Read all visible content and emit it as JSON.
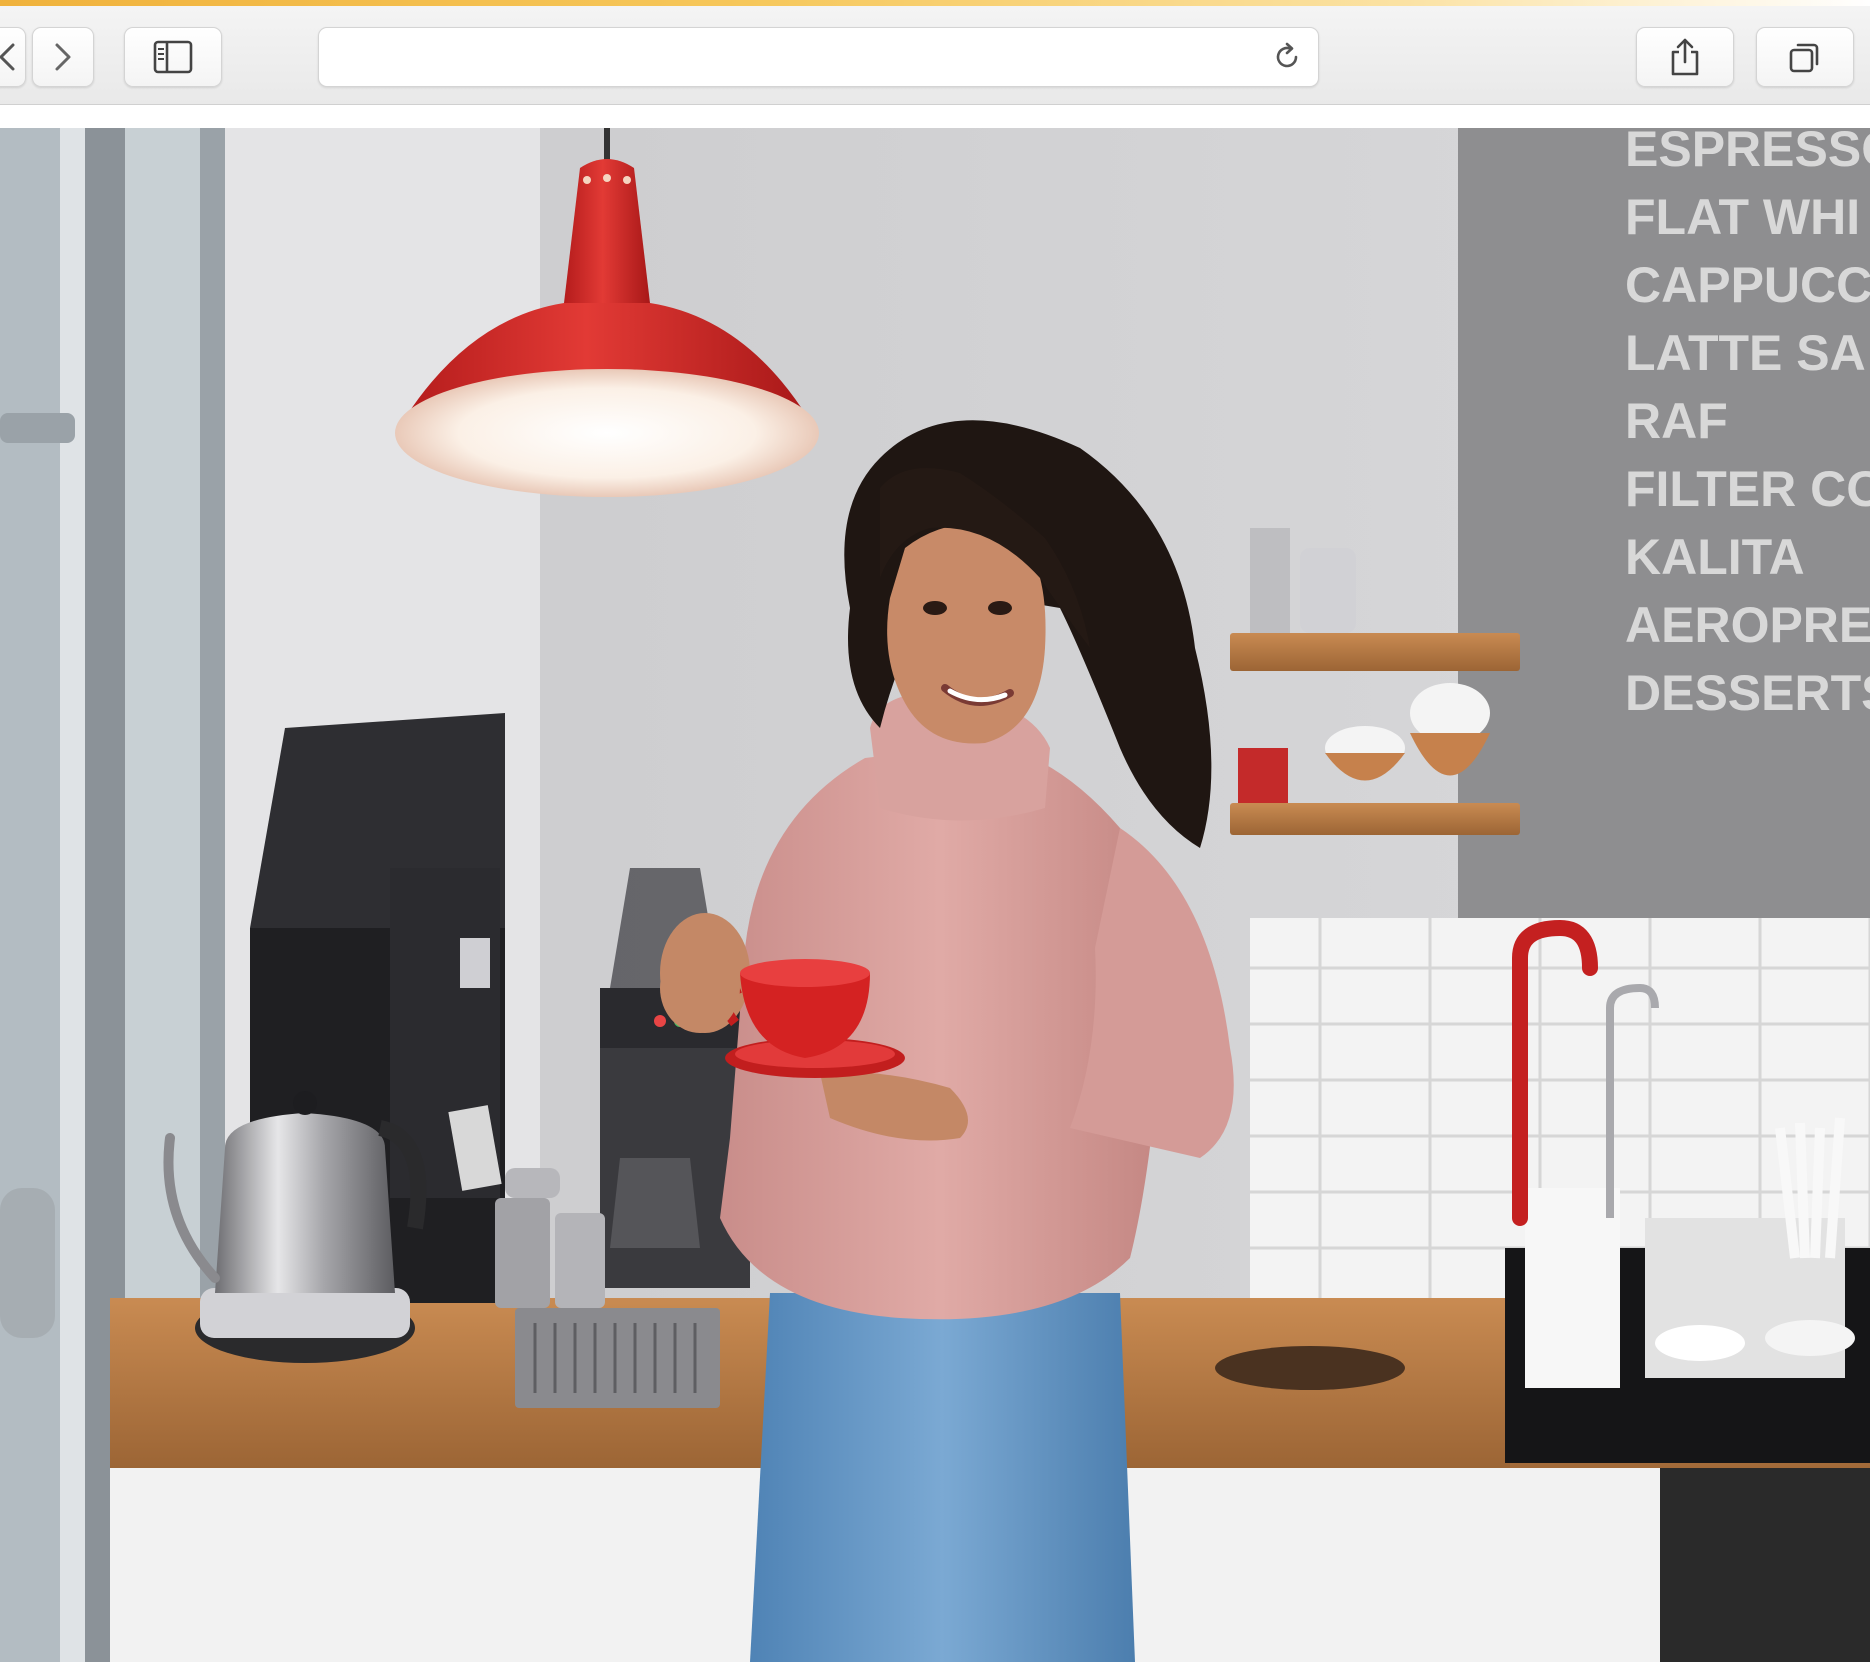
{
  "browser": {
    "address": {
      "value": "",
      "placeholder": ""
    },
    "icons": {
      "back": "chevron-left-icon",
      "forward": "chevron-right-icon",
      "sidebar": "sidebar-icon",
      "reload": "reload-icon",
      "share": "share-icon",
      "tabs": "tabs-icon"
    },
    "colors": {
      "accent": "#f0b23c",
      "toolbar": "#ececec"
    }
  },
  "photo": {
    "menu_board": {
      "items": [
        "ESPRESSO",
        "FLAT WHI",
        "CAPPUCCI",
        "LATTE SA",
        "RAF",
        "FILTER CO",
        "KALITA",
        "AEROPRES",
        "DESSERTS"
      ]
    },
    "colors": {
      "lamp": "#d42a2a",
      "sweater": "#d9a3a0",
      "jeans": "#6b9cc8",
      "cup": "#cf1f1f",
      "counter": "#b87b45",
      "wall": "#cfcfd1",
      "menu_wall": "#8f8f8f"
    }
  }
}
